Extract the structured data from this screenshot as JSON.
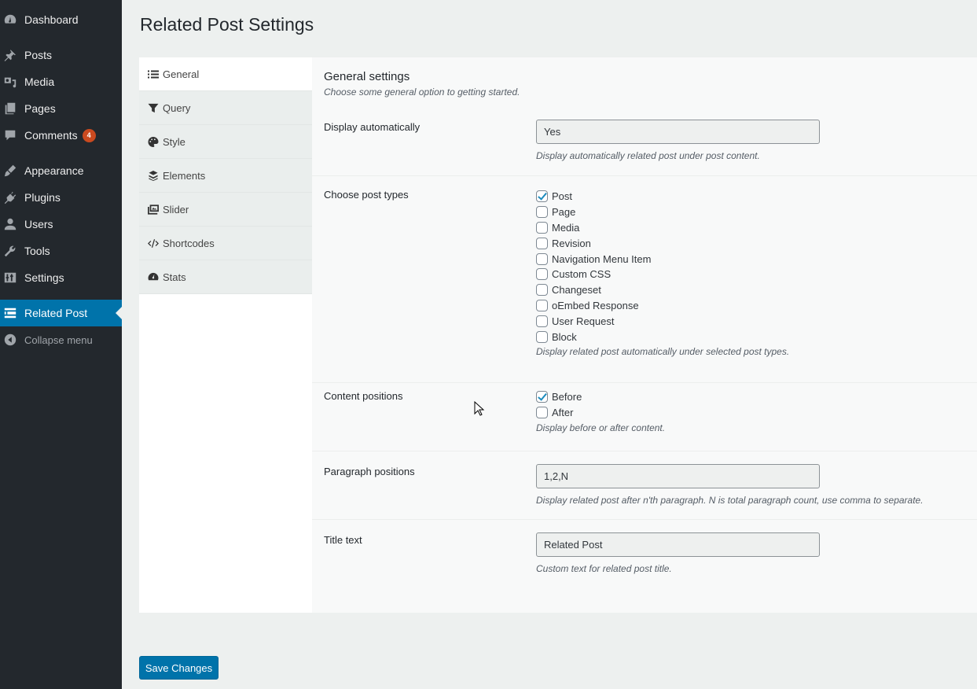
{
  "admin_menu": {
    "items": [
      {
        "label": "Dashboard",
        "icon": "dashboard-icon"
      },
      {
        "label": "Posts",
        "icon": "pin-icon"
      },
      {
        "label": "Media",
        "icon": "media-icon"
      },
      {
        "label": "Pages",
        "icon": "pages-icon"
      },
      {
        "label": "Comments",
        "icon": "comment-icon",
        "badge": "4"
      },
      {
        "label": "Appearance",
        "icon": "brush-icon"
      },
      {
        "label": "Plugins",
        "icon": "plug-icon"
      },
      {
        "label": "Users",
        "icon": "user-icon"
      },
      {
        "label": "Tools",
        "icon": "wrench-icon"
      },
      {
        "label": "Settings",
        "icon": "sliders-icon"
      },
      {
        "label": "Related Post",
        "icon": "list-icon",
        "active": true
      },
      {
        "label": "Collapse menu",
        "icon": "collapse-icon"
      }
    ]
  },
  "page": {
    "title": "Related Post Settings"
  },
  "tabs": [
    {
      "label": "General",
      "icon": "list-icon",
      "active": true
    },
    {
      "label": "Query",
      "icon": "filter-icon"
    },
    {
      "label": "Style",
      "icon": "palette-icon"
    },
    {
      "label": "Elements",
      "icon": "layers-icon"
    },
    {
      "label": "Slider",
      "icon": "images-icon"
    },
    {
      "label": "Shortcodes",
      "icon": "code-icon"
    },
    {
      "label": "Stats",
      "icon": "gauge-icon"
    }
  ],
  "general": {
    "title": "General settings",
    "description": "Choose some general option to getting started.",
    "display_automatically": {
      "label": "Display automatically",
      "value": "Yes",
      "description": "Display automatically related post under post content."
    },
    "post_types": {
      "label": "Choose post types",
      "options": [
        {
          "label": "Post",
          "checked": true
        },
        {
          "label": "Page",
          "checked": false
        },
        {
          "label": "Media",
          "checked": false
        },
        {
          "label": "Revision",
          "checked": false
        },
        {
          "label": "Navigation Menu Item",
          "checked": false
        },
        {
          "label": "Custom CSS",
          "checked": false
        },
        {
          "label": "Changeset",
          "checked": false
        },
        {
          "label": "oEmbed Response",
          "checked": false
        },
        {
          "label": "User Request",
          "checked": false
        },
        {
          "label": "Block",
          "checked": false
        }
      ],
      "description": "Display related post automatically under selected post types."
    },
    "content_positions": {
      "label": "Content positions",
      "options": [
        {
          "label": "Before",
          "checked": true
        },
        {
          "label": "After",
          "checked": false
        }
      ],
      "description": "Display before or after content."
    },
    "paragraph_positions": {
      "label": "Paragraph positions",
      "value": "1,2,N",
      "description": "Display related post after n'th paragraph. N is total paragraph count, use comma to separate."
    },
    "title_text": {
      "label": "Title text",
      "value": "Related Post",
      "description": "Custom text for related post title."
    }
  },
  "save_button": "Save Changes",
  "colors": {
    "admin_bg": "#23282d",
    "accent": "#0073aa",
    "badge": "#ca4a1f",
    "check": "#1e8cbe"
  }
}
